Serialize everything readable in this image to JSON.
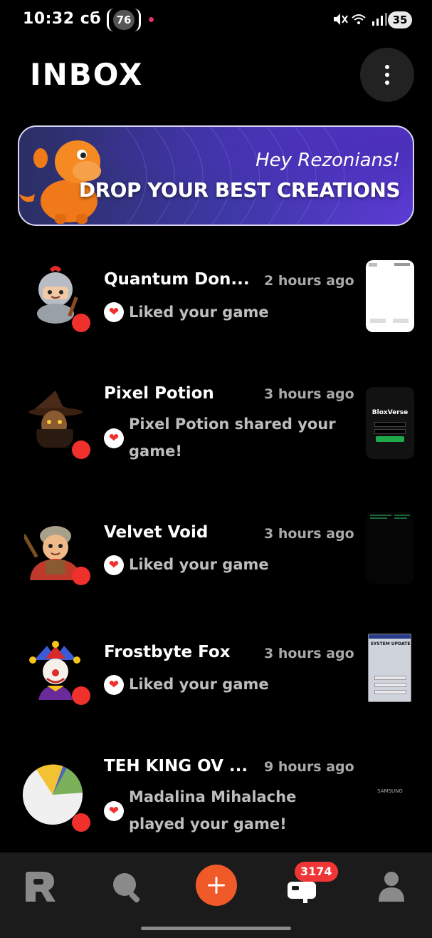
{
  "status_bar": {
    "time": "10:32 сб",
    "notification_count": "76",
    "battery": "35"
  },
  "header": {
    "title": "INBOX"
  },
  "banner": {
    "subtitle": "Hey Rezonians!",
    "headline": "DROP YOUR BEST CREATIONS"
  },
  "notifications": [
    {
      "name": "Quantum Don...",
      "time": "2 hours ago",
      "message": "Liked your game",
      "avatar": "knight-avatar"
    },
    {
      "name": "Pixel Potion",
      "time": "3 hours ago",
      "message": "Pixel Potion shared your game!",
      "avatar": "witch-avatar",
      "thumb_text": "BloxVerse"
    },
    {
      "name": "Velvet Void",
      "time": "3 hours ago",
      "message": "Liked your game",
      "avatar": "warrior-avatar"
    },
    {
      "name": "Frostbyte Fox",
      "time": "3 hours ago",
      "message": "Liked your game",
      "avatar": "jester-avatar",
      "thumb_title": "SYSTEM UPDATE"
    },
    {
      "name": "TEH KING OV ...",
      "time": "9 hours ago",
      "message": "Madalina Mihalache played your game!",
      "avatar": "pie-chart-avatar",
      "thumb_text": "SAMSUNG"
    }
  ],
  "bottom_nav": {
    "badge_count": "3174",
    "items": [
      "home-icon",
      "search-icon",
      "add-icon",
      "inbox-icon",
      "profile-icon"
    ]
  },
  "colors": {
    "accent": "#f05a28",
    "unread": "#f0302c",
    "badge": "#ef3535"
  }
}
